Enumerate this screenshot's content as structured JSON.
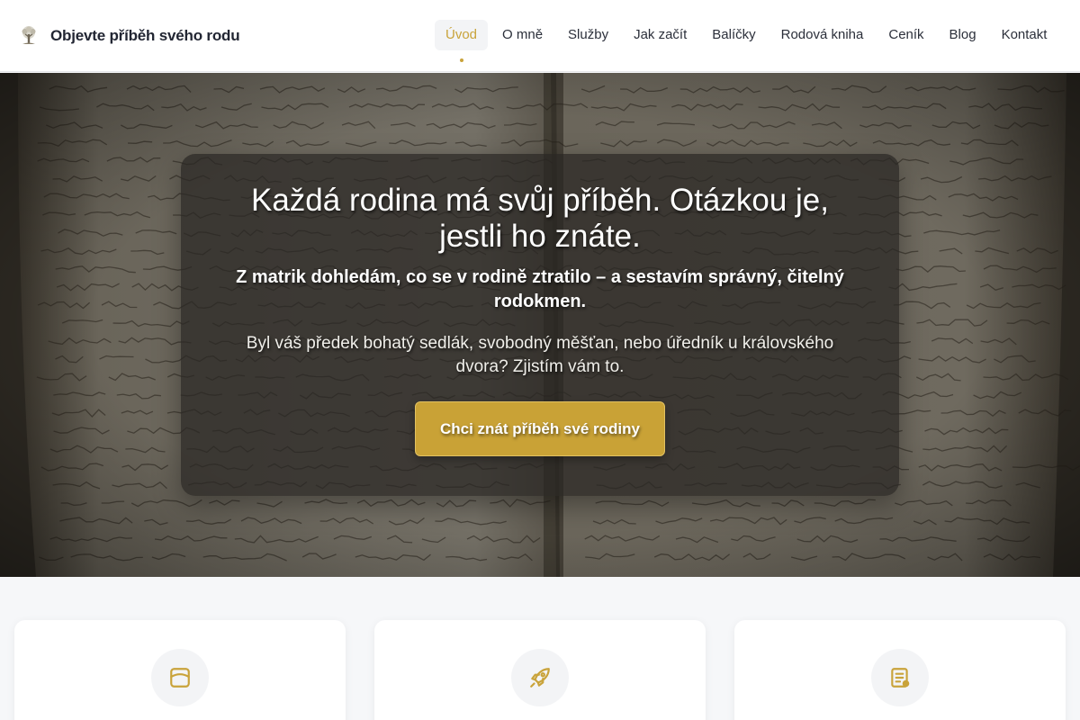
{
  "header": {
    "brand_title": "Objevte příběh svého rodu",
    "logo_icon": "tree-logo-icon",
    "nav": [
      {
        "label": "Úvod",
        "active": true
      },
      {
        "label": "O mně",
        "active": false
      },
      {
        "label": "Služby",
        "active": false
      },
      {
        "label": "Jak začít",
        "active": false
      },
      {
        "label": "Balíčky",
        "active": false
      },
      {
        "label": "Rodová kniha",
        "active": false
      },
      {
        "label": "Ceník",
        "active": false
      },
      {
        "label": "Blog",
        "active": false
      },
      {
        "label": "Kontakt",
        "active": false
      }
    ]
  },
  "hero": {
    "heading": "Každá rodina má svůj příběh. Otázkou je, jestli ho znáte.",
    "subheading": "Z matrik dohledám, co se v rodině ztratilo – a sestavím správný, čitelný rodokmen.",
    "text": "Byl váš předek bohatý sedlák, svobodný měšťan, nebo úředník u královského dvora? Zjistím vám to.",
    "cta_label": "Chci znát příběh své rodiny",
    "background": "old-parish-register-book"
  },
  "features": [
    {
      "icon": "archive-box-icon"
    },
    {
      "icon": "rocket-icon"
    },
    {
      "icon": "document-list-icon"
    }
  ],
  "colors": {
    "accent": "#c9a33a",
    "header_bg": "#ffffff",
    "page_bg": "#f6f7f9",
    "overlay": "#282622"
  }
}
